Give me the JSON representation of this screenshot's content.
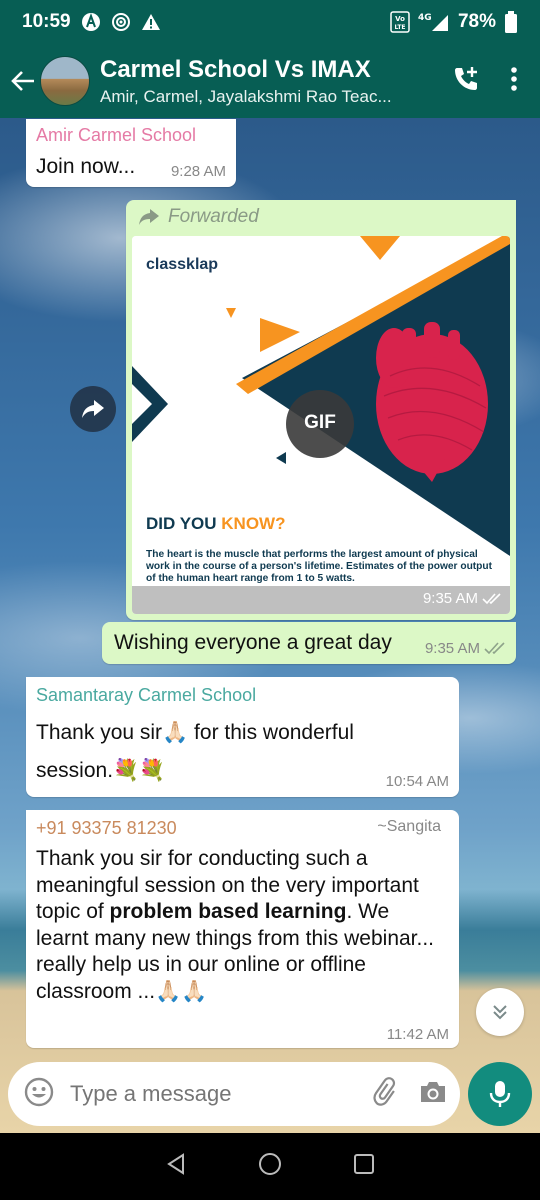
{
  "status": {
    "time": "10:59",
    "battery": "78%",
    "network": "4G",
    "volte": "Vo LTE"
  },
  "chat": {
    "title": "Carmel School Vs IMAX",
    "subtitle": "Amir, Carmel, Jayalakshmi Rao Teac..."
  },
  "messages": {
    "m1": {
      "sender": "Amir Carmel School",
      "text": "Join now...",
      "time": "9:28 AM"
    },
    "m2": {
      "forwarded": "Forwarded",
      "gif_badge": "GIF",
      "brand": "classklap",
      "headline_a": "DID YOU ",
      "headline_b": "KNOW?",
      "fact": "The heart is the muscle that performs the largest amount of physical work in the course of a person's lifetime. Estimates of the power output of the human heart range from 1 to 5 watts.",
      "time": "9:35 AM"
    },
    "m3": {
      "text": "Wishing everyone a great day",
      "time": "9:35 AM"
    },
    "m4": {
      "sender": "Samantaray Carmel School",
      "text_a": "Thank you sir",
      "emoji_a": "🙏🏻",
      "text_b": " for this wonderful",
      "text_c": "session.",
      "emoji_c": "💐💐",
      "time": "10:54 AM"
    },
    "m5": {
      "phone": "+91 93375 81230",
      "push_name": "~Sangita",
      "text_1": "Thank you sir for conducting such a meaningful session on the very important topic of ",
      "text_bold": "problem based learning",
      "text_2": ". We learnt many new things from this webinar... really help us in our online or offline classroom ...",
      "emoji": "🙏🏻🙏🏻",
      "time": "11:42 AM"
    }
  },
  "composer": {
    "placeholder": "Type a message"
  },
  "colors": {
    "header": "#075e54",
    "outgoing": "#dcf8c6",
    "sender1": "#e57aa5",
    "sender2": "#4aa9a0",
    "sender3": "#c98a5d",
    "mic": "#128c7e"
  }
}
